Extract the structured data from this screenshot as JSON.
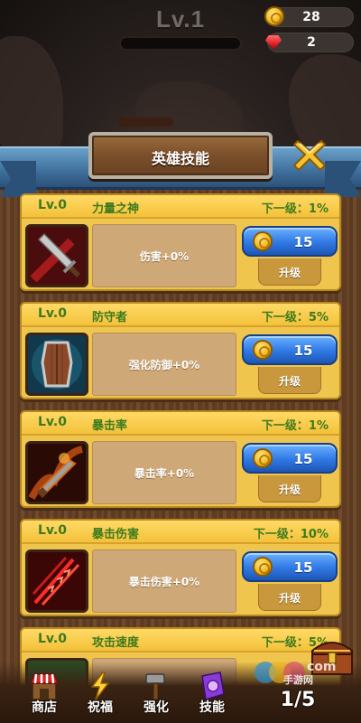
{
  "header": {
    "level": "Lv.1",
    "xp_progress": 0,
    "coins": "28",
    "gems": "2",
    "currency_icons": [
      "coin-icon",
      "gem-icon"
    ]
  },
  "panel": {
    "title": "英雄技能",
    "close_icon": "close-icon"
  },
  "skills": [
    {
      "level": "Lv.0",
      "name": "力量之神",
      "next": "下一级：1%",
      "effect_label": "伤害",
      "effect_value": "+0%",
      "cost": "15",
      "upgrade_label": "升级",
      "icon": "sword-icon"
    },
    {
      "level": "Lv.0",
      "name": "防守者",
      "next": "下一级：5%",
      "effect_label": "强化防御",
      "effect_value": "+0%",
      "cost": "15",
      "upgrade_label": "升级",
      "icon": "shield-icon"
    },
    {
      "level": "Lv.0",
      "name": "暴击率",
      "next": "下一级：1%",
      "effect_label": "暴击率",
      "effect_value": "+0%",
      "cost": "15",
      "upgrade_label": "升级",
      "icon": "flaming-sword-icon"
    },
    {
      "level": "Lv.0",
      "name": "暴击伤害",
      "next": "下一级：10%",
      "effect_label": "暴击伤害",
      "effect_value": "+0%",
      "cost": "15",
      "upgrade_label": "升级",
      "icon": "claw-slash-icon"
    },
    {
      "level": "Lv.0",
      "name": "攻击速度",
      "next": "下一级：5%"
    }
  ],
  "nav": {
    "items": [
      {
        "label": "商店",
        "icon": "shop-icon"
      },
      {
        "label": "祝福",
        "icon": "lightning-icon"
      },
      {
        "label": "强化",
        "icon": "hammer-icon"
      },
      {
        "label": "技能",
        "icon": "skill-book-icon"
      }
    ],
    "page": "1/5",
    "chest_icon": "treasure-chest-icon"
  },
  "watermark": {
    "text": "手游网",
    "domain": "com"
  },
  "colors": {
    "card": "#f0c54e",
    "card_text": "#3c7a1e",
    "cost_button": "#2f78e4",
    "ribbon": "#3e6f9c"
  }
}
